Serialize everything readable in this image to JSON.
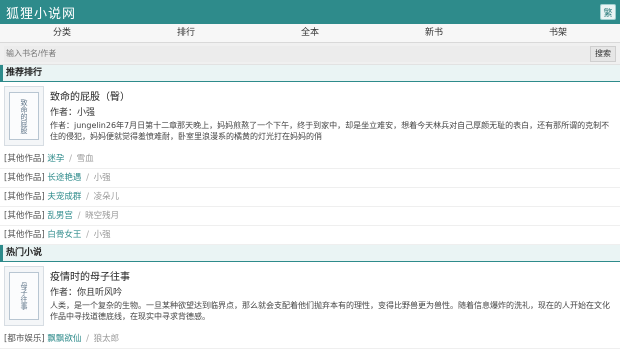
{
  "header": {
    "site_title": "狐狸小说网",
    "trad_button": "繁"
  },
  "nav": [
    "分类",
    "排行",
    "全本",
    "新书",
    "书架"
  ],
  "search": {
    "placeholder": "输入书名/作者",
    "button": "搜索"
  },
  "recommend": {
    "section_title": "推荐排行",
    "featured": {
      "title": "致命的屁股（臀）",
      "author": "作者：小强",
      "intro": "作者：jungelin26年7月日第十二章那天晚上，妈妈煎熬了一个下午，终于到家中，却是坐立难安，想着今天林兵对自己厚颜无耻的表白，还有那所谓的克制不住的侵犯，妈妈便就觉得羞愤难耐，卧室里浪漫系的橘黄的灯光打在妈妈的俏",
      "cover_text": "致命的屁股"
    },
    "others": [
      {
        "tag": "[其他作品]",
        "title": "迷孕",
        "author": "雪血"
      },
      {
        "tag": "[其他作品]",
        "title": "长途艳遇",
        "author": "小强"
      },
      {
        "tag": "[其他作品]",
        "title": "夫宠成群",
        "author": "凌朵儿"
      },
      {
        "tag": "[其他作品]",
        "title": "乱男宫",
        "author": "晓空残月"
      },
      {
        "tag": "[其他作品]",
        "title": "白骨女王",
        "author": "小强"
      }
    ]
  },
  "hot": {
    "section_title": "热门小说",
    "featured": {
      "title": "疫情时的母子往事",
      "author": "作者：你且听风吟",
      "intro": "人类，是一个复杂的生物。一旦某种欲望达到临界点，那么就会支配着他们抛弃本有的理性，变得比野兽更为兽性。随着信息爆炸的洗礼，现在的人开始在文化作品中寻找道德底线，在现实中寻求背德感。",
      "cover_text": "母子往事"
    },
    "others": [
      {
        "tag": "[都市娱乐]",
        "title": "飘飘欲仙",
        "author": "狼太郎"
      }
    ]
  }
}
